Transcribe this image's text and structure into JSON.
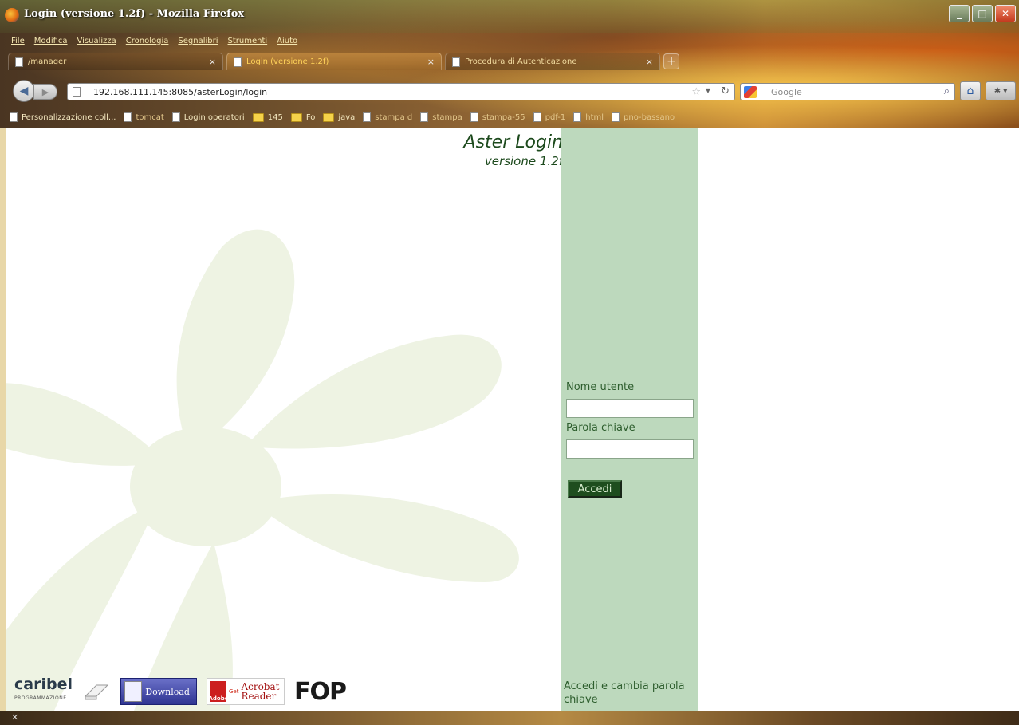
{
  "window": {
    "title": "Login (versione 1.2f) - Mozilla Firefox",
    "buttons": {
      "minimize": "_",
      "maximize": "□",
      "close": "✕"
    }
  },
  "menu": [
    "File",
    "Modifica",
    "Visualizza",
    "Cronologia",
    "Segnalibri",
    "Strumenti",
    "Aiuto"
  ],
  "tabs": [
    {
      "label": "/manager",
      "active": false
    },
    {
      "label": "Login (versione 1.2f)",
      "active": true
    },
    {
      "label": "Procedura di Autenticazione",
      "active": false
    }
  ],
  "nav": {
    "url": "192.168.111.145:8085/asterLogin/login",
    "search_placeholder": "Google"
  },
  "bookmarks": [
    {
      "label": "Personalizzazione coll...",
      "type": "page"
    },
    {
      "label": "tomcat",
      "type": "page"
    },
    {
      "label": "Login operatori",
      "type": "page"
    },
    {
      "label": "145",
      "type": "folder"
    },
    {
      "label": "Fo",
      "type": "folder"
    },
    {
      "label": "java",
      "type": "folder"
    },
    {
      "label": "stampa d",
      "type": "page"
    },
    {
      "label": "stampa",
      "type": "page"
    },
    {
      "label": "stampa-55",
      "type": "page"
    },
    {
      "label": "pdf-1",
      "type": "page"
    },
    {
      "label": "html",
      "type": "page"
    },
    {
      "label": "pno-bassano",
      "type": "page"
    }
  ],
  "page": {
    "title": "Aster Login",
    "version": "versione 1.2f",
    "username_label": "Nome utente",
    "username_value": "",
    "password_label": "Parola chiave",
    "password_value": "",
    "submit_label": "Accedi",
    "change_password_link": "Accedi e cambia parola chiave"
  },
  "logos": {
    "caribel": "caribel",
    "caribel_sub": "PROGRAMMAZIONE",
    "download": "Download",
    "acrobat_get": "Get",
    "acrobat_name": "Acrobat",
    "acrobat_reader": "Reader",
    "adobe": "Adobe",
    "fop": "FOP"
  },
  "colors": {
    "panel": "#bdd9bd",
    "button": "#1e4d1e",
    "text_green": "#2e5e2e"
  }
}
